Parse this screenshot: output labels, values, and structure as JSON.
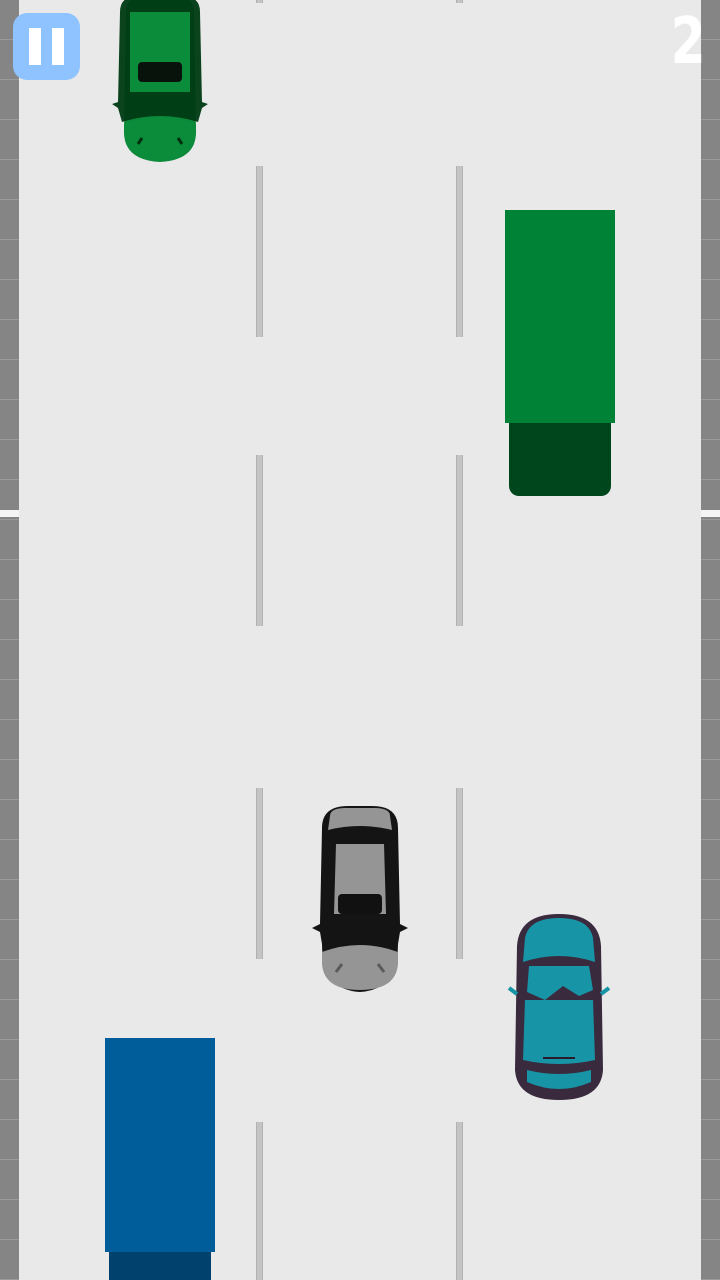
{
  "hud": {
    "score": "2",
    "pause_icon": "pause-icon"
  },
  "colors": {
    "road": "#e9e9e9",
    "shoulder": "#858585",
    "lane_marking": "#c4c4c4",
    "pause_button": "#8ec3ff",
    "green_truck_trailer": "#008236",
    "green_truck_cab": "#00461c",
    "blue_truck_trailer": "#005d99",
    "blue_truck_cab": "#00426d",
    "green_car": "#0a8a3a",
    "gray_car": "#959595",
    "teal_car": "#1795a6"
  }
}
